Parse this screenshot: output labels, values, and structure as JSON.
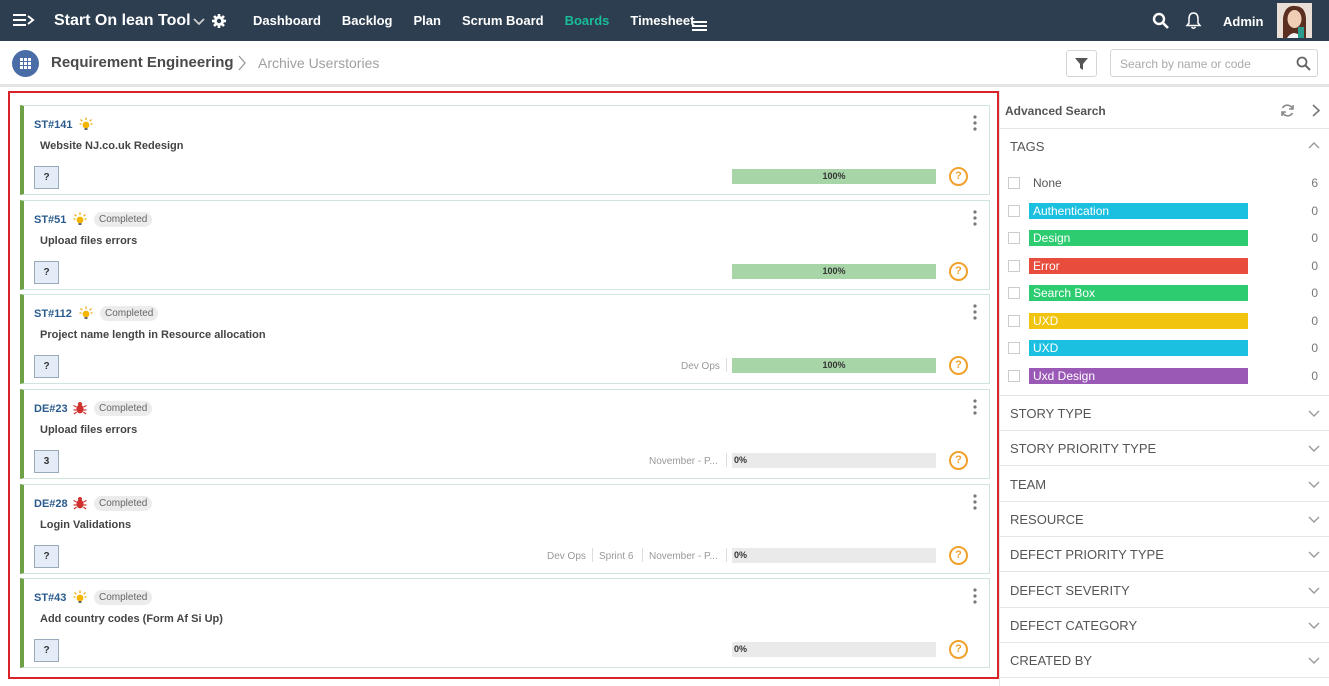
{
  "topbar": {
    "app_title": "Start On lean Tool",
    "nav": [
      "Dashboard",
      "Backlog",
      "Plan",
      "Scrum Board",
      "Boards",
      "Timesheet"
    ],
    "active_nav": "Boards",
    "user": "Admin"
  },
  "breadcrumb": {
    "project": "Requirement Engineering",
    "page": "Archive Userstories"
  },
  "search": {
    "placeholder": "Search by name or code"
  },
  "cards": [
    {
      "id": "ST#141",
      "type": "story",
      "status": "",
      "title": "Website NJ.co.uk Redesign",
      "estimate": "?",
      "meta": [],
      "progress": 100,
      "progress_label": "100%"
    },
    {
      "id": "ST#51",
      "type": "story",
      "status": "Completed",
      "title": "Upload files errors",
      "estimate": "?",
      "meta": [],
      "progress": 100,
      "progress_label": "100%"
    },
    {
      "id": "ST#112",
      "type": "story",
      "status": "Completed",
      "title": "Project name length in Resource allocation",
      "estimate": "?",
      "meta": [
        "Dev Ops"
      ],
      "progress": 100,
      "progress_label": "100%"
    },
    {
      "id": "DE#23",
      "type": "defect",
      "status": "Completed",
      "title": "Upload files errors",
      "estimate": "3",
      "meta": [
        "November - P..."
      ],
      "progress": 0,
      "progress_label": "0%"
    },
    {
      "id": "DE#28",
      "type": "defect",
      "status": "Completed",
      "title": "Login Validations",
      "estimate": "?",
      "meta": [
        "Dev Ops",
        "Sprint 6",
        "November - P..."
      ],
      "progress": 0,
      "progress_label": "0%"
    },
    {
      "id": "ST#43",
      "type": "story",
      "status": "Completed",
      "title": "Add country codes (Form Af Si Up)",
      "estimate": "?",
      "meta": [],
      "progress": 0,
      "progress_label": "0%"
    }
  ],
  "panel": {
    "title": "Advanced Search",
    "tags_title": "TAGS",
    "tags": [
      {
        "label": "None",
        "count": "6",
        "color": ""
      },
      {
        "label": "Authentication",
        "count": "0",
        "color": "#1bbfe0"
      },
      {
        "label": "Design",
        "count": "0",
        "color": "#2ecc71"
      },
      {
        "label": "Error",
        "count": "0",
        "color": "#e74c3c"
      },
      {
        "label": "Search Box",
        "count": "0",
        "color": "#2ecc71"
      },
      {
        "label": "UXD",
        "count": "0",
        "color": "#f1c40f"
      },
      {
        "label": "UXD",
        "count": "0",
        "color": "#1bbfe0"
      },
      {
        "label": "Uxd Design",
        "count": "0",
        "color": "#9b59b6"
      }
    ],
    "sections": [
      "STORY TYPE",
      "STORY PRIORITY TYPE",
      "TEAM",
      "RESOURCE",
      "DEFECT PRIORITY TYPE",
      "DEFECT SEVERITY",
      "DEFECT CATEGORY",
      "CREATED BY"
    ]
  }
}
